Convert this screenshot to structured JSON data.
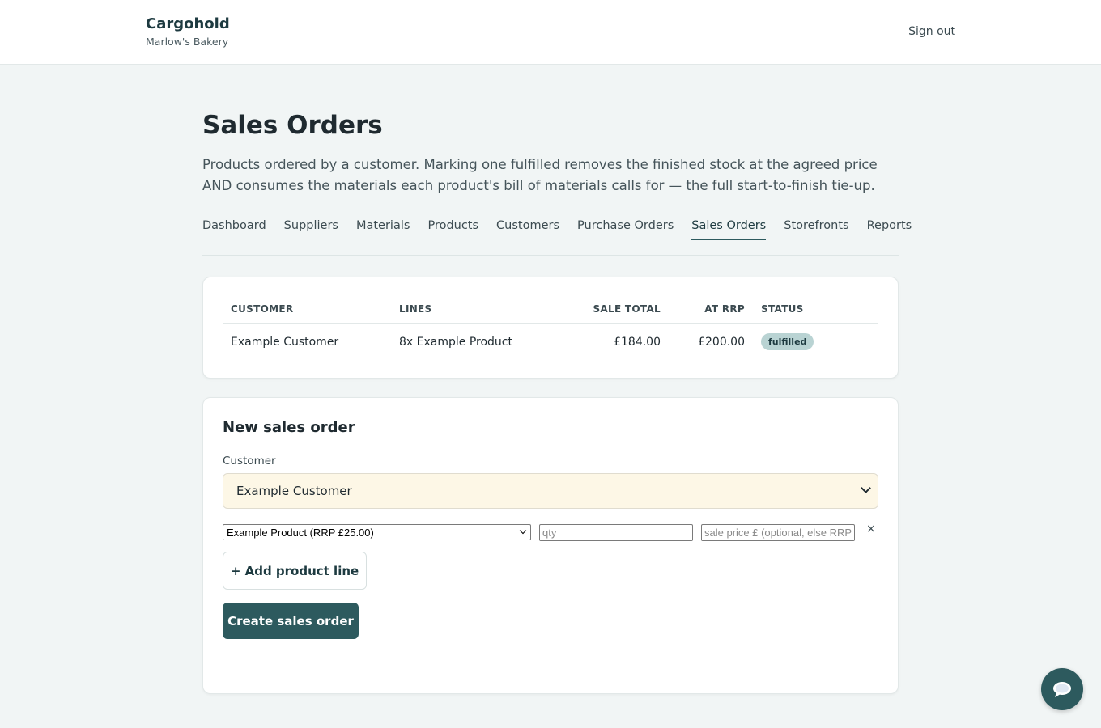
{
  "header": {
    "brand": "Cargohold",
    "org": "Marlow's Bakery",
    "signout": "Sign out"
  },
  "page": {
    "title": "Sales Orders",
    "description": "Products ordered by a customer. Marking one fulfilled removes the finished stock at the agreed price AND consumes the materials each product's bill of materials calls for — the full start-to-finish tie-up."
  },
  "nav": {
    "items": [
      "Dashboard",
      "Suppliers",
      "Materials",
      "Products",
      "Customers",
      "Purchase Orders",
      "Sales Orders",
      "Storefronts",
      "Reports"
    ],
    "active": "Sales Orders"
  },
  "orders_table": {
    "columns": [
      "CUSTOMER",
      "LINES",
      "SALE TOTAL",
      "AT RRP",
      "STATUS"
    ],
    "rows": [
      {
        "customer": "Example Customer",
        "lines": "8x Example Product",
        "sale_total": "£184.00",
        "at_rrp": "£200.00",
        "status": "fulfilled"
      }
    ]
  },
  "new_order": {
    "title": "New sales order",
    "customer_label": "Customer",
    "customer_value": "Example Customer",
    "line": {
      "product_value": "Example Product (RRP £25.00)",
      "qty_placeholder": "qty",
      "price_placeholder": "sale price £ (optional, else RRP)",
      "remove": "×"
    },
    "add_line_label": "+ Add product line",
    "create_label": "Create sales order"
  },
  "colors": {
    "accent": "#2d5a5e",
    "badge_bg": "#b9d3d3",
    "select_bg": "#fdf7e6",
    "page_bg": "#f1f5f5"
  },
  "icons": {
    "chat": "chat-bubble-icon"
  }
}
